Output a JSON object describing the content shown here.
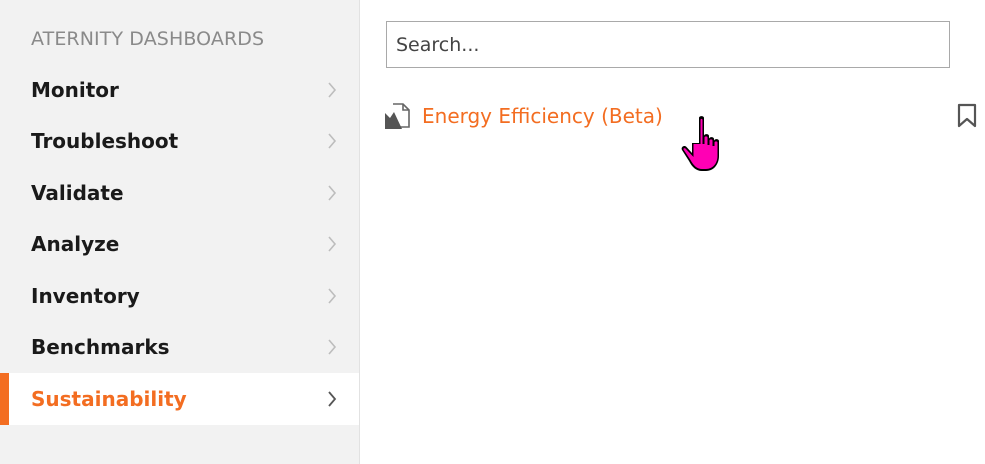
{
  "sidebar": {
    "heading": "ATERNITY DASHBOARDS",
    "items": [
      {
        "label": "Monitor",
        "active": false
      },
      {
        "label": "Troubleshoot",
        "active": false
      },
      {
        "label": "Validate",
        "active": false
      },
      {
        "label": "Analyze",
        "active": false
      },
      {
        "label": "Inventory",
        "active": false
      },
      {
        "label": "Benchmarks",
        "active": false
      },
      {
        "label": "Sustainability",
        "active": true
      }
    ]
  },
  "search": {
    "placeholder": "Search..."
  },
  "results": [
    {
      "label": "Energy Efficiency (Beta)",
      "icon": "dashboard-document-icon"
    }
  ],
  "colors": {
    "accent": "#f36d21",
    "sidebar_bg": "#f2f2f2",
    "heading": "#8a8a8a",
    "cursor": "#ff00b4"
  }
}
